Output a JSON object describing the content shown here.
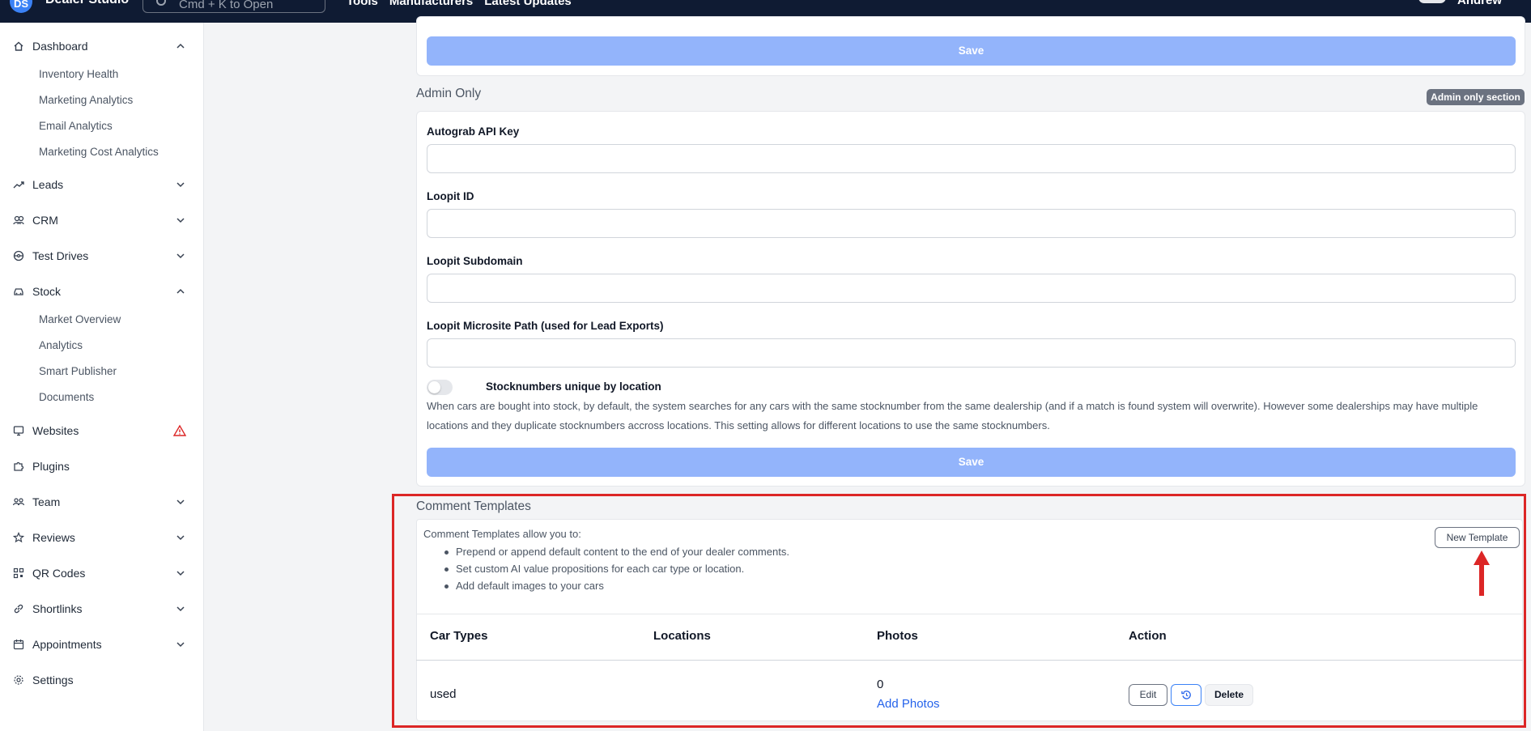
{
  "topbar": {
    "logo_text": "DS",
    "brand": "Dealer Studio",
    "search_placeholder": "Cmd + K to Open",
    "nav": [
      "Tools",
      "Manufacturers",
      "Latest Updates"
    ],
    "user_name": "Andrew"
  },
  "sidebar": {
    "dashboard": {
      "label": "Dashboard",
      "icon": "home-icon",
      "subs": [
        "Inventory Health",
        "Marketing Analytics",
        "Email Analytics",
        "Marketing Cost Analytics"
      ]
    },
    "leads": {
      "label": "Leads",
      "icon": "trend-icon"
    },
    "crm": {
      "label": "CRM",
      "icon": "users-icon"
    },
    "test_drives": {
      "label": "Test Drives",
      "icon": "steering-wheel-icon"
    },
    "stock": {
      "label": "Stock",
      "icon": "car-icon",
      "subs": [
        "Market Overview",
        "Analytics",
        "Smart Publisher",
        "Documents"
      ]
    },
    "websites": {
      "label": "Websites",
      "icon": "monitor-icon",
      "alert_color": "#dc2626"
    },
    "plugins": {
      "label": "Plugins",
      "icon": "puzzle-icon"
    },
    "team": {
      "label": "Team",
      "icon": "team-icon"
    },
    "reviews": {
      "label": "Reviews",
      "icon": "star-icon"
    },
    "qr_codes": {
      "label": "QR Codes",
      "icon": "qr-icon"
    },
    "shortlinks": {
      "label": "Shortlinks",
      "icon": "link-icon"
    },
    "appointments": {
      "label": "Appointments",
      "icon": "calendar-icon"
    },
    "settings": {
      "label": "Settings",
      "icon": "gear-icon"
    }
  },
  "main": {
    "save_label": "Save",
    "admin": {
      "title": "Admin Only",
      "badge": "Admin only section",
      "fields": [
        {
          "label": "Autograb API Key",
          "value": ""
        },
        {
          "label": "Loopit ID",
          "value": ""
        },
        {
          "label": "Loopit Subdomain",
          "value": ""
        },
        {
          "label": "Loopit Microsite Path (used for Lead Exports)",
          "value": ""
        }
      ],
      "toggle_label": "Stocknumbers unique by location",
      "toggle_on": false,
      "help": "When cars are bought into stock, by default, the system searches for any cars with the same stocknumber from the same dealership (and if a match is found system will overwrite). However some dealerships may have multiple locations and they duplicate stocknumbers accross locations. This setting allows for different locations to use the same stocknumbers."
    },
    "comment_templates": {
      "title": "Comment Templates",
      "intro": "Comment Templates allow you to:",
      "bullets": [
        "Prepend or append default content to the end of your dealer comments.",
        "Set custom AI value propositions for each car type or location.",
        "Add default images to your cars"
      ],
      "new_button": "New Template",
      "columns": [
        "Car Types",
        "Locations",
        "Photos",
        "Action"
      ],
      "rows": [
        {
          "car_types": "used",
          "locations": "",
          "photo_count": "0",
          "add_photos": "Add Photos",
          "edit": "Edit",
          "history_icon": "history-icon",
          "delete": "Delete"
        }
      ]
    }
  },
  "colors": {
    "highlight": "#dc2626",
    "accent": "#2563eb",
    "save_button": "#93b4fb"
  }
}
